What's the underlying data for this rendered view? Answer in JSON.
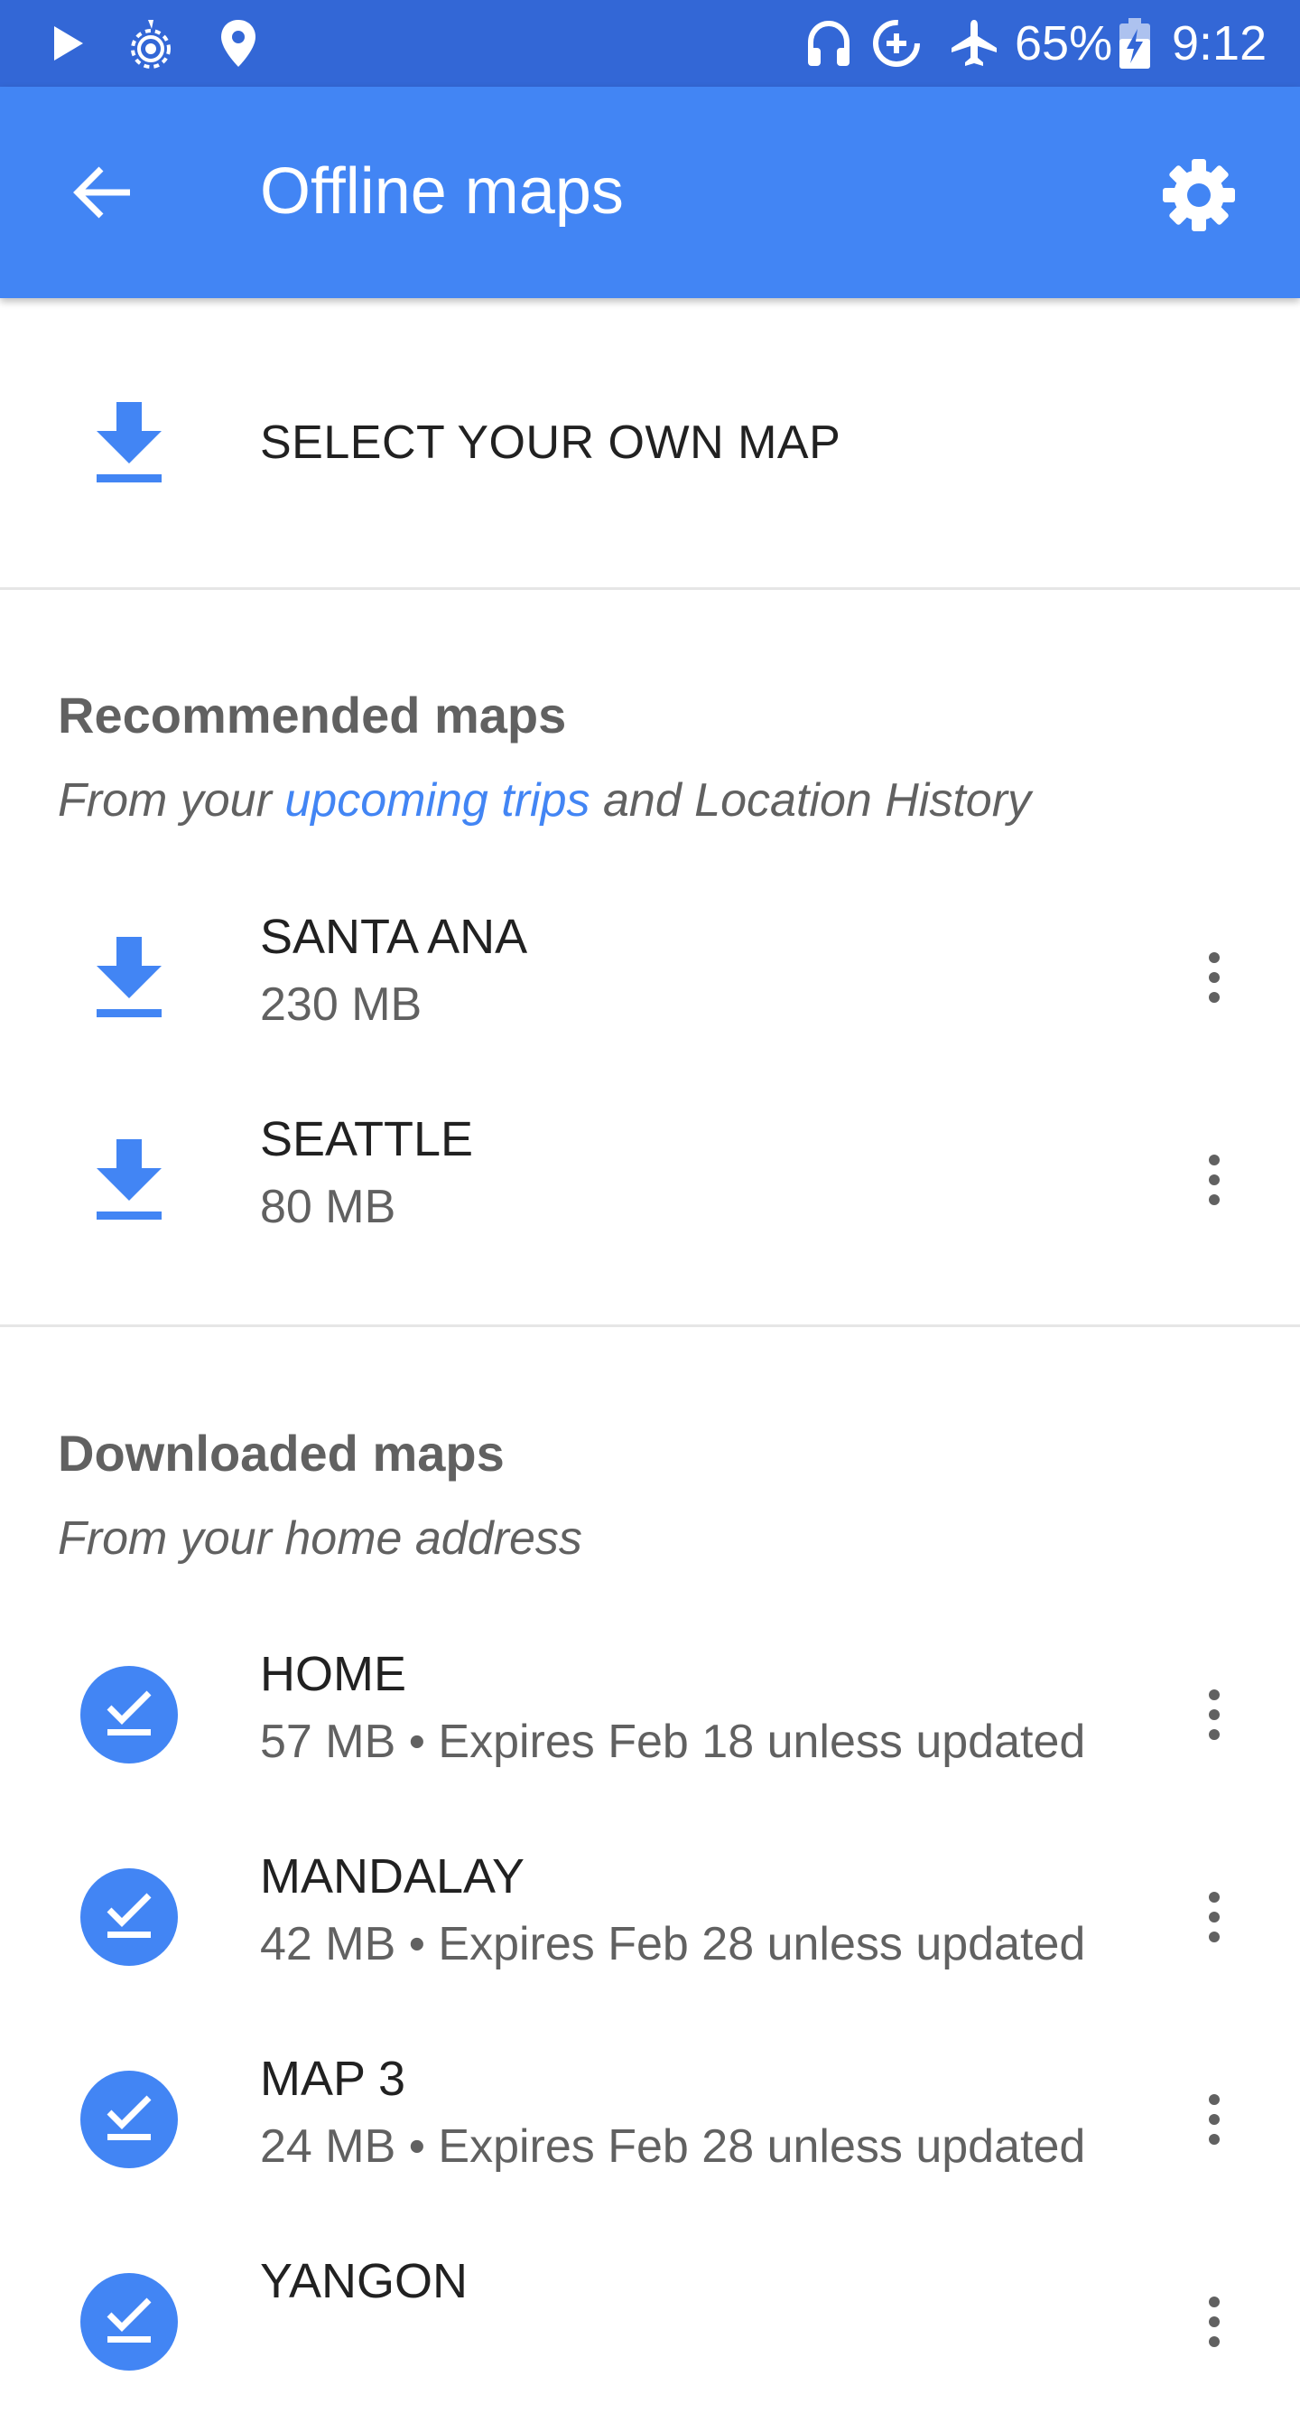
{
  "status_bar": {
    "battery": "65%",
    "time": "9:12",
    "icons": [
      "play-icon",
      "hotspot-icon",
      "location-pin-icon",
      "headphones-icon",
      "data-saver-icon",
      "airplane-icon",
      "battery-charging-icon"
    ]
  },
  "app_bar": {
    "title": "Offline maps",
    "back_icon": "arrow-back-icon",
    "settings_icon": "gear-icon"
  },
  "select_own": {
    "label": "SELECT YOUR OWN MAP"
  },
  "recommended": {
    "title": "Recommended maps",
    "subtitle_prefix": "From your ",
    "subtitle_link": "upcoming trips",
    "subtitle_suffix": " and Location History",
    "items": [
      {
        "name": "SANTA ANA",
        "size": "230 MB"
      },
      {
        "name": "SEATTLE",
        "size": "80 MB"
      }
    ]
  },
  "downloaded": {
    "title": "Downloaded maps",
    "subtitle": "From your home address",
    "items": [
      {
        "name": "HOME",
        "meta": "57 MB • Expires Feb 18 unless updated"
      },
      {
        "name": "MANDALAY",
        "meta": "42 MB • Expires Feb 28 unless updated"
      },
      {
        "name": "MAP 3",
        "meta": "24 MB • Expires Feb 28 unless updated"
      },
      {
        "name": "YANGON",
        "meta": ""
      }
    ]
  },
  "colors": {
    "status_bar": "#3367d6",
    "app_bar": "#4285f4",
    "accent": "#4285f4",
    "secondary_text": "#616161"
  }
}
